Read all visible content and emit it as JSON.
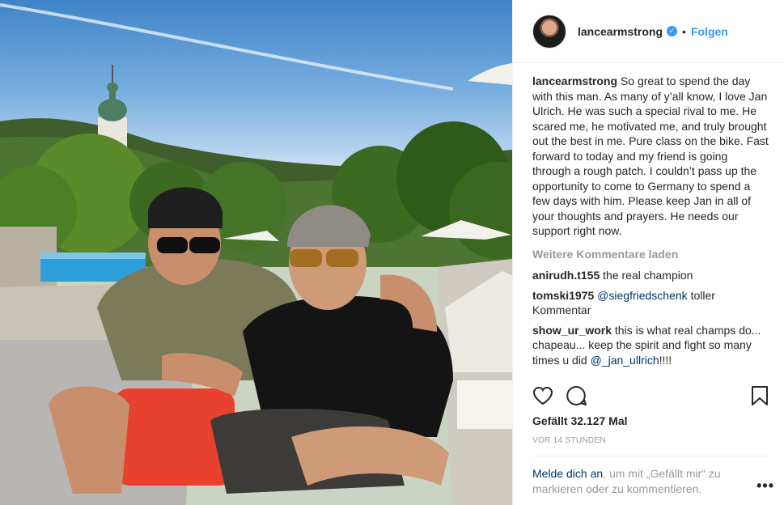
{
  "post": {
    "photo_alt": "photo",
    "header": {
      "username": "lancearmstrong",
      "separator": "•",
      "follow_label": "Folgen"
    },
    "caption": {
      "username": "lancearmstrong",
      "text": "So great to spend the day with this man. As many of y’all know, I love Jan Ulrich. He was such a special rival to me. He scared me, he motivated me, and truly brought out the best in me. Pure class on the bike. Fast forward to today and my friend is going through a rough patch. I couldn’t pass up the opportunity to come to Germany to spend a few days with him. Please keep Jan in all of your thoughts and prayers. He needs our support right now."
    },
    "load_more_label": "Weitere Kommentare laden",
    "comments": [
      {
        "username": "anirudh.t155",
        "text": "the real champion"
      },
      {
        "username": "tomski1975",
        "mention": "@siegfriedschenk",
        "text": "toller Kommentar"
      },
      {
        "username": "show_ur_work",
        "text": "this is what real champs do... chapeau... keep the spirit and fight so many times u did",
        "mention": "@_jan_ullrich",
        "suffix": "!!!!"
      }
    ],
    "likes_label": "Gefällt 32.127 Mal",
    "timestamp": "VOR 14 STUNDEN",
    "login_prompt": {
      "link": "Melde dich an",
      "text": ", um mit „Gefällt mir“ zu markieren oder zu kommentieren."
    },
    "more_options": "•••",
    "verified_glyph": "✓"
  },
  "icons": [
    "heart-icon",
    "comment-icon",
    "bookmark-icon",
    "verified-badge-icon"
  ]
}
